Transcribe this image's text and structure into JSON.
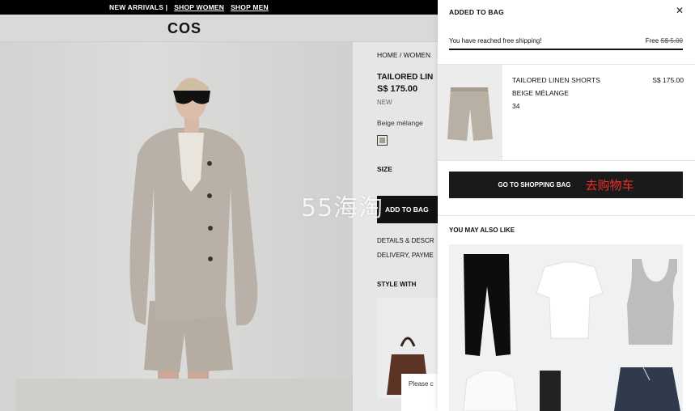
{
  "promo": {
    "new_arrivals": "NEW ARRIVALS |",
    "shop_women": "SHOP WOMEN",
    "shop_men": "SHOP MEN"
  },
  "header": {
    "logo": "COS"
  },
  "product": {
    "breadcrumb": "HOME /  WOMEN",
    "title": "TAILORED LIN",
    "price": "S$ 175.00",
    "badge": "NEW",
    "color_name": "Beige mélange",
    "size_label": "SIZE",
    "add_to_bag": "ADD TO BAG",
    "details_label": "DETAILS & DESCR",
    "delivery_label": "DELIVERY, PAYME",
    "style_with": "STYLE WITH",
    "please_text": "Please c"
  },
  "watermark": "55海淘",
  "cart": {
    "title": "ADDED TO BAG",
    "shipping_message": "You have reached free shipping!",
    "shipping_free": "Free",
    "shipping_old_price": "S$ 5.00",
    "item": {
      "name": "TAILORED LINEN SHORTS",
      "price": "S$ 175.00",
      "color": "BEIGE MÉLANGE",
      "size": "34"
    },
    "go_to_bag": "GO TO SHOPPING BAG",
    "go_to_bag_zh": "去购物车",
    "you_may_also_like": "YOU MAY ALSO LIKE"
  },
  "colors": {
    "accent_red": "#e8312a",
    "black": "#111111",
    "swatch": "#a69c92"
  }
}
